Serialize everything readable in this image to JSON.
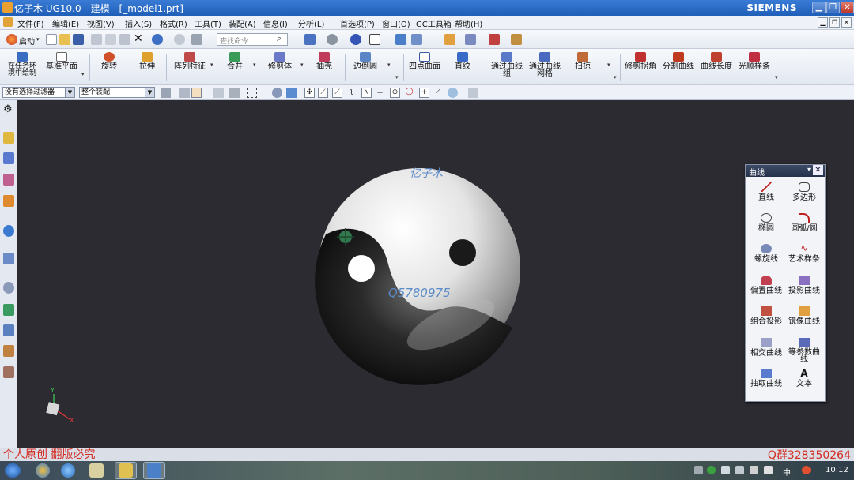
{
  "window": {
    "title": "亿子木 UG10.0 - 建模 - [_model1.prt]",
    "brand": "SIEMENS"
  },
  "menubar": {
    "items": [
      "文件(F)",
      "编辑(E)",
      "视图(V)",
      "插入(S)",
      "格式(R)",
      "工具(T)",
      "装配(A)",
      "信息(I)",
      "分析(L)",
      "首选项(P)",
      "窗口(O)",
      "GC工具箱",
      "帮助(H)"
    ]
  },
  "toolbar1": {
    "start_label": "启动",
    "search_placeholder": "查找命令"
  },
  "toolbar2": {
    "buttons": [
      "在任务环境中绘制",
      "基准平面",
      "旋转",
      "拉伸",
      "阵列特征",
      "合并",
      "修剪体",
      "抽壳",
      "边倒圆",
      "四点曲面",
      "直纹",
      "通过曲线组",
      "通过曲线网格",
      "扫掠",
      "修剪拐角",
      "分割曲线",
      "曲线长度",
      "光顺样条"
    ]
  },
  "selection_bar": {
    "filter_value": "没有选择过滤器",
    "scope_value": "整个装配"
  },
  "viewport": {
    "watermark_top": "亿子木",
    "watermark_mid": "Q5780975"
  },
  "curve_panel": {
    "title": "曲线",
    "items": [
      "直线",
      "多边形",
      "椭圆",
      "圆弧/圆",
      "螺旋线",
      "艺术样条",
      "偏置曲线",
      "投影曲线",
      "组合投影",
      "镜像曲线",
      "相交曲线",
      "等参数曲线",
      "抽取曲线",
      "文本"
    ]
  },
  "overlay": {
    "copyright": "个人原创  翻版必究",
    "qq_group": "Q群328350264"
  },
  "taskbar": {
    "ime": "中",
    "time": "10:12"
  },
  "colors": {
    "titlebar": "#2a6bc6",
    "viewport_bg": "#2b2b31",
    "watermark_red": "#d42a20",
    "watermark_blue": "#5a8ac8"
  }
}
